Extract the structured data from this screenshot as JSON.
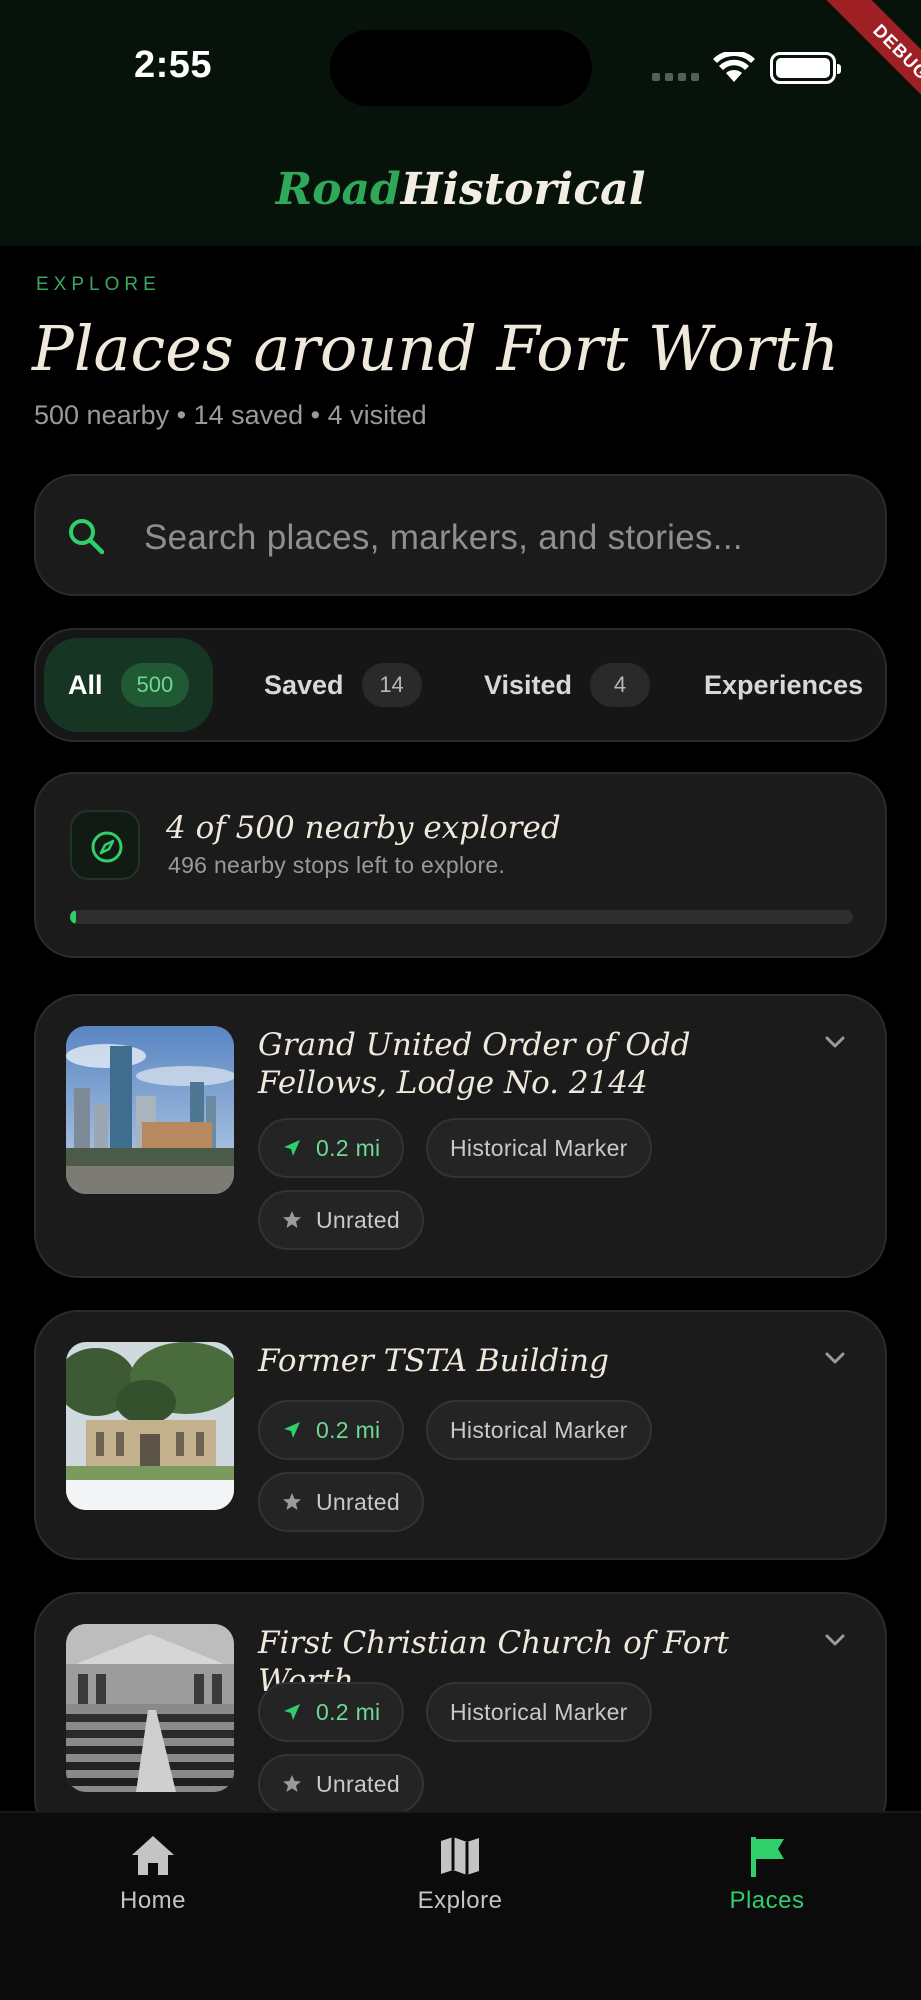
{
  "status_bar": {
    "time": "2:55",
    "debug_label": "DEBUG"
  },
  "app_bar": {
    "brand_part1": "Road",
    "brand_part2": "Historical"
  },
  "header": {
    "eyebrow": "EXPLORE",
    "title": "Places around Fort Worth",
    "subtitle": "500 nearby • 14 saved • 4 visited"
  },
  "search": {
    "placeholder": "Search places, markers, and stories..."
  },
  "tabs": [
    {
      "label": "All",
      "count": "500",
      "active": true
    },
    {
      "label": "Saved",
      "count": "14",
      "active": false
    },
    {
      "label": "Visited",
      "count": "4",
      "active": false
    },
    {
      "label": "Experiences",
      "count": "",
      "active": false
    }
  ],
  "progress": {
    "title": "4 of 500 nearby explored",
    "subtitle": "496 nearby stops left to explore.",
    "fraction": 0.008
  },
  "places": [
    {
      "title": "Grand United Order of Odd Fellows, Lodge No. 2144",
      "distance": "0.2 mi",
      "category": "Historical Marker",
      "rating": "Unrated"
    },
    {
      "title": "Former TSTA Building",
      "distance": "0.2 mi",
      "category": "Historical Marker",
      "rating": "Unrated"
    },
    {
      "title": "First Christian Church of Fort Worth",
      "distance": "0.2 mi",
      "category": "Historical Marker",
      "rating": "Unrated"
    }
  ],
  "bottom_nav": [
    {
      "label": "Home",
      "icon": "home-icon",
      "active": false
    },
    {
      "label": "Explore",
      "icon": "map-icon",
      "active": false
    },
    {
      "label": "Places",
      "icon": "flag-icon",
      "active": true
    }
  ],
  "colors": {
    "accent": "#2fcf6c",
    "brand_green": "#2fa85a",
    "background": "#000000",
    "card": "#1b1b1c"
  }
}
